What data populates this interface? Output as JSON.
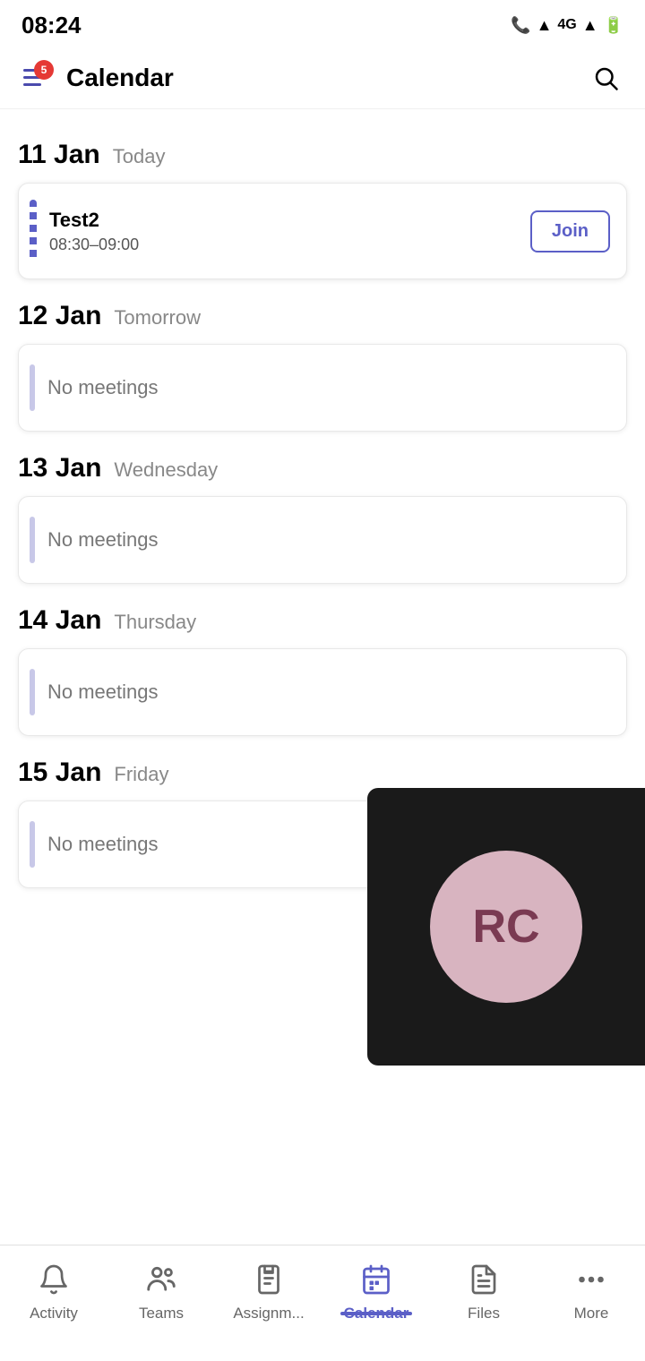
{
  "statusBar": {
    "time": "08:24",
    "icons": [
      "sim",
      "wifi",
      "4g",
      "signal",
      "battery"
    ]
  },
  "header": {
    "title": "Calendar",
    "notificationCount": "5"
  },
  "calendar": {
    "dates": [
      {
        "date": "11 Jan",
        "label": "Today",
        "meetings": [
          {
            "title": "Test2",
            "time": "08:30–09:00",
            "hasJoin": true,
            "joinLabel": "Join"
          }
        ]
      },
      {
        "date": "12 Jan",
        "label": "Tomorrow",
        "meetings": []
      },
      {
        "date": "13 Jan",
        "label": "Wednesday",
        "meetings": []
      },
      {
        "date": "14 Jan",
        "label": "Thursday",
        "meetings": []
      },
      {
        "date": "15 Jan",
        "label": "Friday",
        "meetings": []
      }
    ],
    "noMeetingsText": "No meetings"
  },
  "profile": {
    "initials": "RC"
  },
  "bottomNav": {
    "items": [
      {
        "id": "activity",
        "label": "Activity",
        "active": false
      },
      {
        "id": "teams",
        "label": "Teams",
        "active": false
      },
      {
        "id": "assignments",
        "label": "Assignm...",
        "active": false
      },
      {
        "id": "calendar",
        "label": "Calendar",
        "active": true
      },
      {
        "id": "files",
        "label": "Files",
        "active": false
      },
      {
        "id": "more",
        "label": "More",
        "active": false
      }
    ]
  }
}
